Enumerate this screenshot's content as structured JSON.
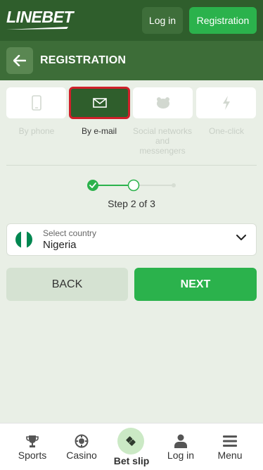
{
  "header": {
    "logo_text": "LINEBET",
    "login_label": "Log in",
    "register_label": "Registration"
  },
  "page": {
    "title": "REGISTRATION"
  },
  "methods": [
    {
      "label": "By phone",
      "icon": "phone-icon",
      "active": false
    },
    {
      "label": "By e-mail",
      "icon": "envelope-icon",
      "active": true
    },
    {
      "label": "Social networks and messengers",
      "icon": "social-icon",
      "active": false
    },
    {
      "label": "One-click",
      "icon": "lightning-icon",
      "active": false
    }
  ],
  "stepper": {
    "current": 2,
    "total": 3,
    "label": "Step 2 of 3"
  },
  "country": {
    "caption": "Select country",
    "value": "Nigeria",
    "flag_colors": [
      "#008751",
      "#ffffff",
      "#008751"
    ]
  },
  "actions": {
    "back_label": "BACK",
    "next_label": "NEXT"
  },
  "nav": [
    {
      "label": "Sports",
      "icon": "trophy-icon"
    },
    {
      "label": "Casino",
      "icon": "casino-chip-icon"
    },
    {
      "label": "Bet slip",
      "icon": "ticket-icon"
    },
    {
      "label": "Log in",
      "icon": "user-icon"
    },
    {
      "label": "Menu",
      "icon": "hamburger-icon"
    }
  ],
  "colors": {
    "brand_dark": "#2f5e2c",
    "brand_header": "#3d6d38",
    "accent_green": "#2bb24c",
    "highlight_red": "#d0202a",
    "background": "#e9efe6"
  }
}
